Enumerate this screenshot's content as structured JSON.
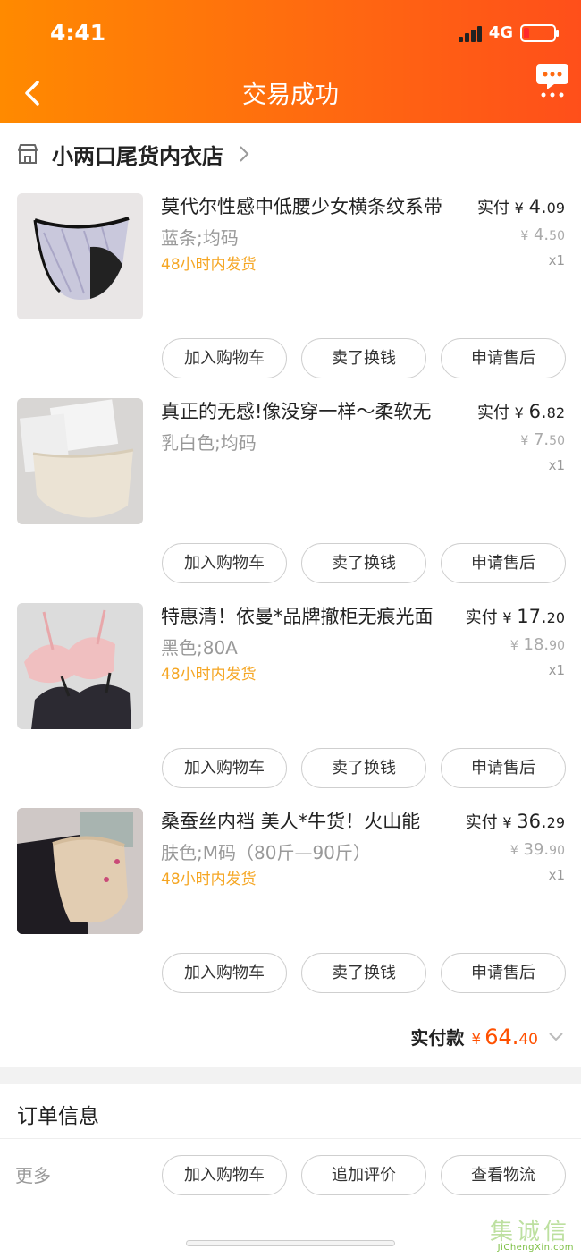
{
  "status_bar": {
    "time": "4:41",
    "network": "4G"
  },
  "header": {
    "title": "交易成功"
  },
  "shop": {
    "name": "小两口尾货内衣店"
  },
  "items": [
    {
      "name": "莫代尔性感中低腰少女横条纹系带",
      "spec": "蓝条;均码",
      "shipping": "48小时内发货",
      "paid_label": "实付",
      "currency": "¥",
      "paid_int": "4.",
      "paid_dec": "09",
      "orig_int": "4.",
      "orig_dec": "50",
      "qty": "x1"
    },
    {
      "name": "真正的无感!像没穿一样～柔软无",
      "spec": "乳白色;均码",
      "shipping": "",
      "paid_label": "实付",
      "currency": "¥",
      "paid_int": "6.",
      "paid_dec": "82",
      "orig_int": "7.",
      "orig_dec": "50",
      "qty": "x1"
    },
    {
      "name": "特惠清！依曼*品牌撤柜无痕光面",
      "spec": "黑色;80A",
      "shipping": "48小时内发货",
      "paid_label": "实付",
      "currency": "¥",
      "paid_int": "17.",
      "paid_dec": "20",
      "orig_int": "18.",
      "orig_dec": "90",
      "qty": "x1"
    },
    {
      "name": "桑蚕丝内裆 美人*牛货！火山能",
      "spec": "肤色;M码（80斤—90斤）",
      "shipping": "48小时内发货",
      "paid_label": "实付",
      "currency": "¥",
      "paid_int": "36.",
      "paid_dec": "29",
      "orig_int": "39.",
      "orig_dec": "90",
      "qty": "x1"
    }
  ],
  "item_buttons": {
    "add_cart": "加入购物车",
    "resell": "卖了换钱",
    "after_sale": "申请售后"
  },
  "total": {
    "label": "实付款",
    "currency": "¥",
    "int": "64.",
    "dec": "40"
  },
  "order_info": {
    "title": "订单信息",
    "more": "更多"
  },
  "bottom_buttons": {
    "add_cart": "加入购物车",
    "review": "追加评价",
    "logistics": "查看物流"
  },
  "watermark": {
    "brand": "集诚信",
    "url": "JiChengXin.com"
  },
  "colors": {
    "accent": "#ff5000",
    "header_start": "#ff8a00",
    "header_end": "#ff4f1a",
    "shipping": "#f5a623"
  }
}
